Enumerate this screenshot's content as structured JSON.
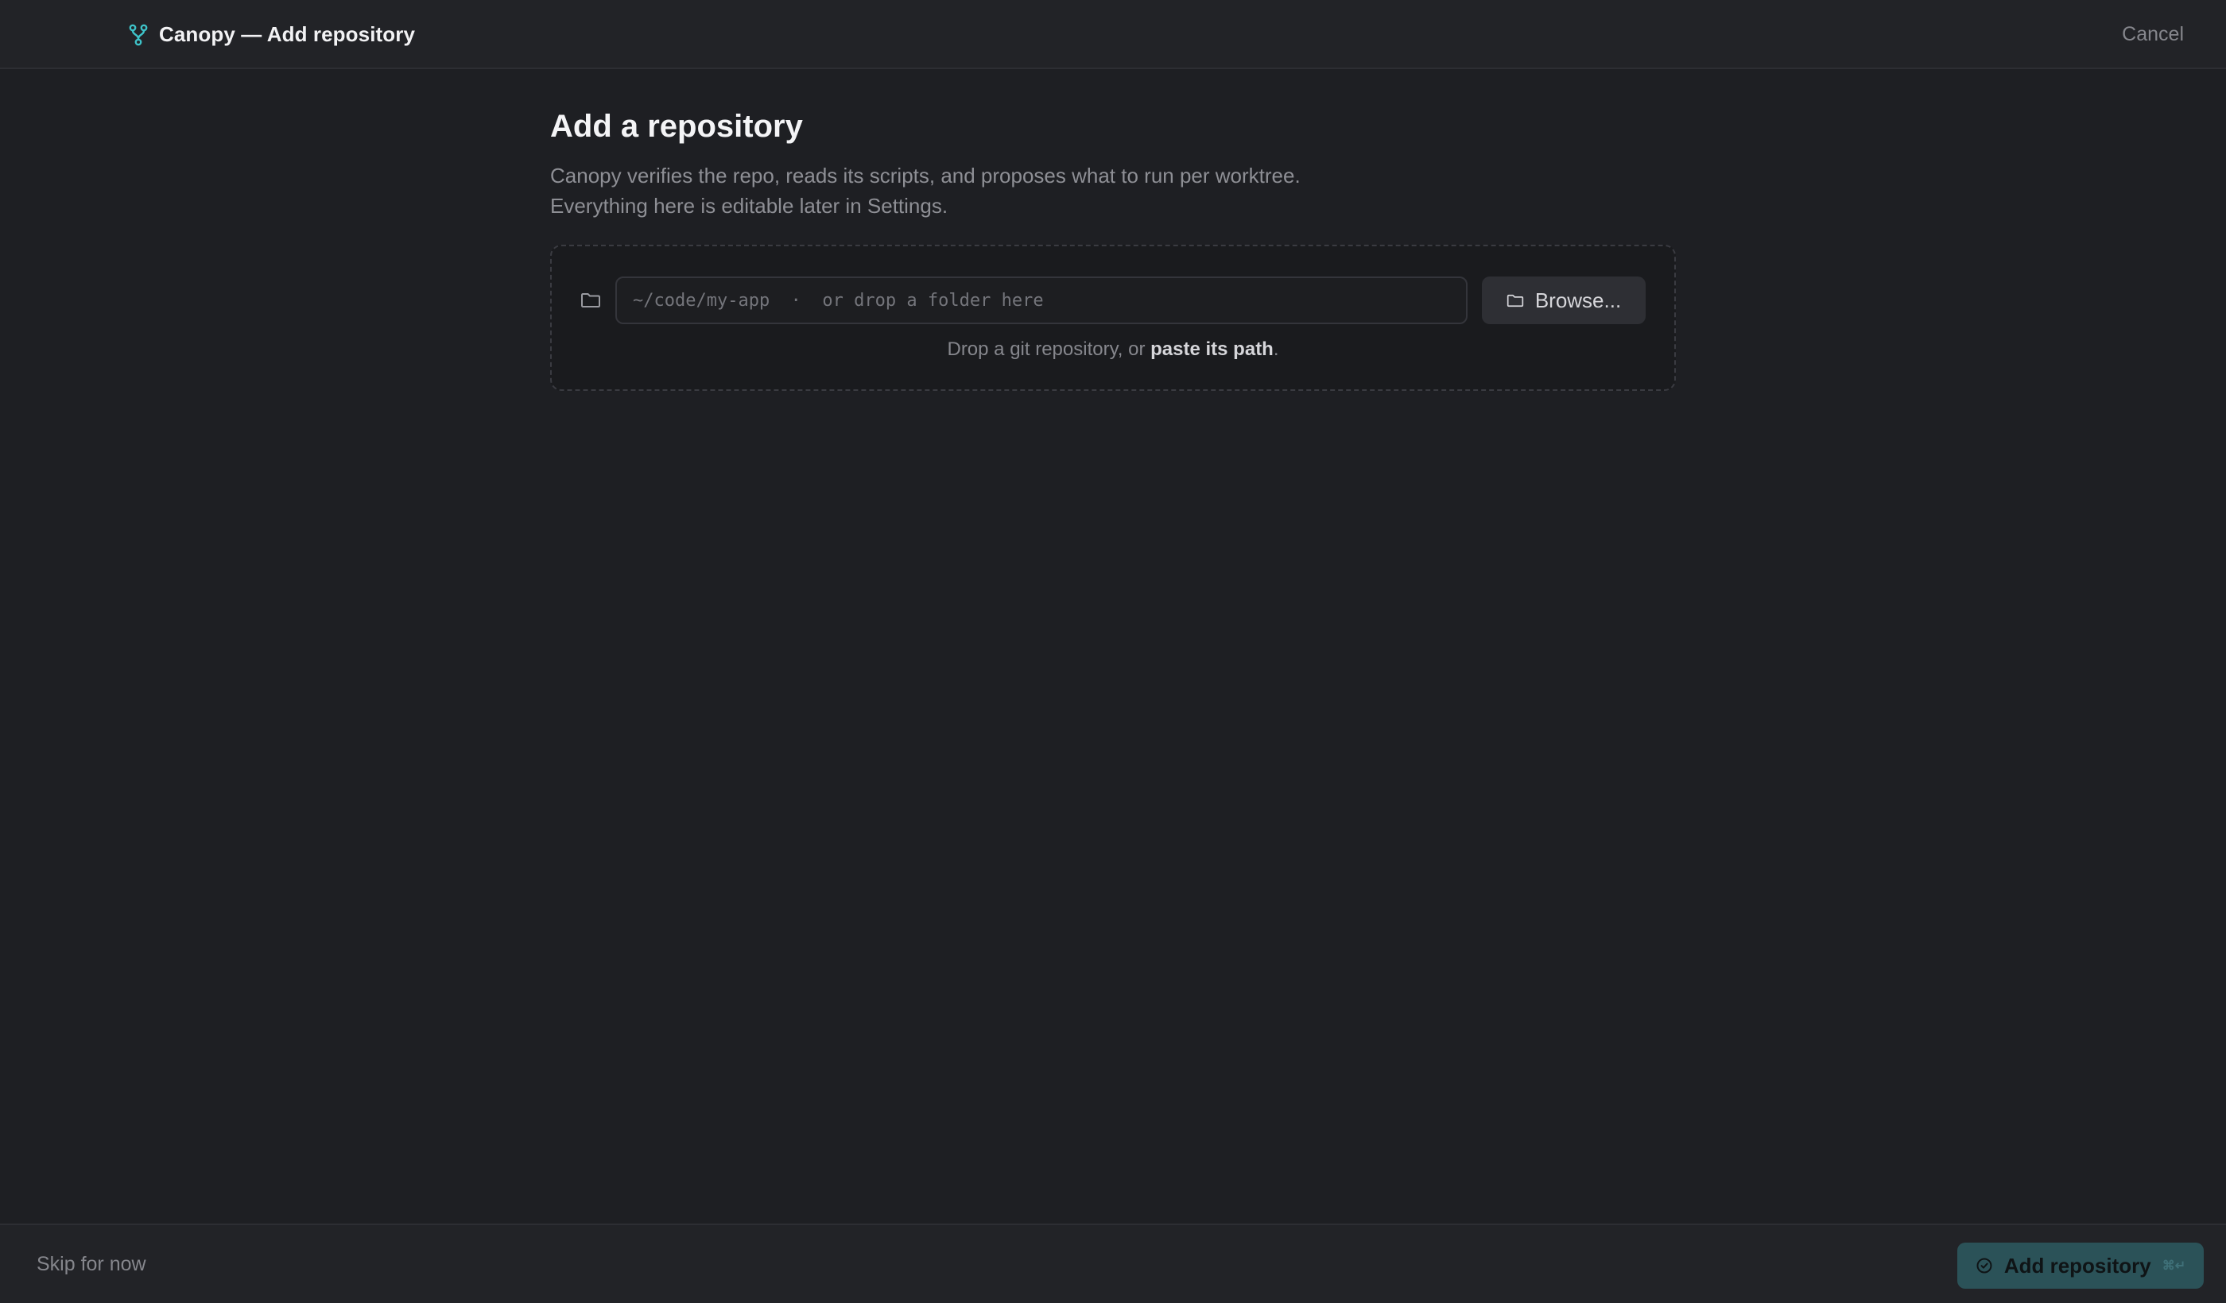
{
  "header": {
    "title": "Canopy — Add repository",
    "logo_icon": "git-branch-icon",
    "cancel_label": "Cancel"
  },
  "main": {
    "title": "Add a repository",
    "subtitle_line1": "Canopy verifies the repo, reads its scripts, and proposes what to run per worktree.",
    "subtitle_line2": "Everything here is editable later in Settings."
  },
  "drop_zone": {
    "input_value": "",
    "input_placeholder": "~/code/my-app  ·  or drop a folder here",
    "browse_label": "Browse...",
    "hint_prefix": "Drop a git repository, or ",
    "hint_strong": "paste its path",
    "hint_suffix": "."
  },
  "footer": {
    "skip_label": "Skip for now",
    "add_label": "Add repository",
    "add_shortcut": "⌘↵",
    "add_icon": "check-circle-icon"
  },
  "colors": {
    "accent": "#3ec3c9",
    "primary_button_bg": "#2b5258",
    "background": "#1e1f23"
  }
}
